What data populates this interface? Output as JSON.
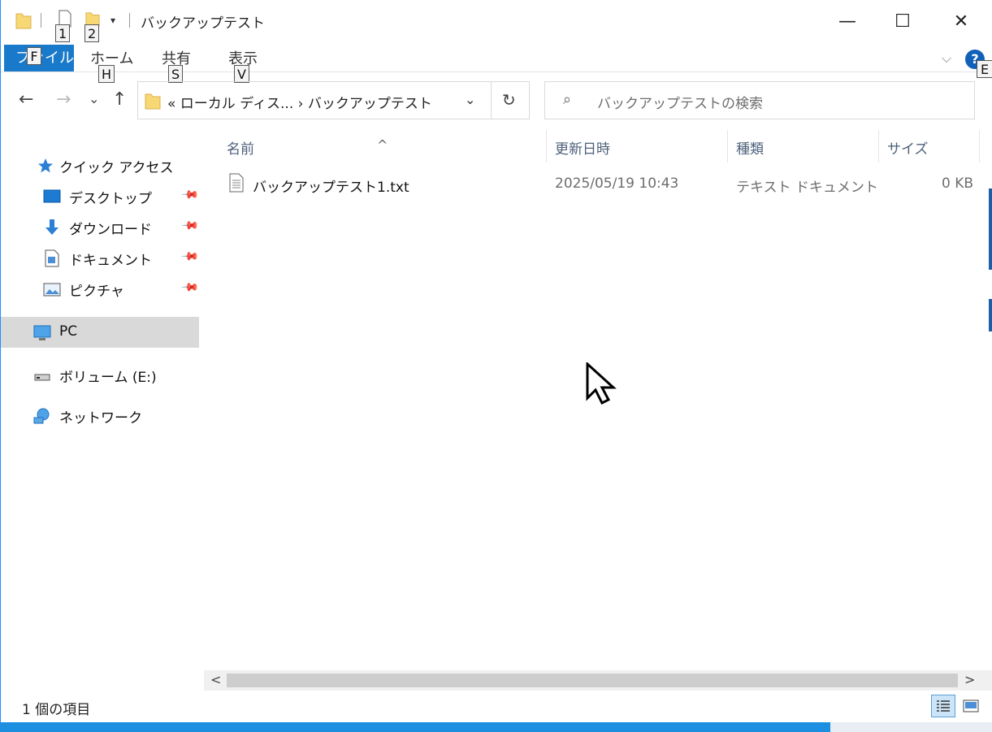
{
  "window": {
    "title": "バックアップテスト",
    "qat_keytips": [
      "1",
      "2"
    ],
    "qat_dropdown": "▾",
    "minimize": "—",
    "maximize": "☐",
    "close": "✕"
  },
  "ribbon": {
    "tabs": [
      {
        "label": "ファイル",
        "keytip": "F"
      },
      {
        "label": "ホーム",
        "keytip": "H"
      },
      {
        "label": "共有",
        "keytip": "S"
      },
      {
        "label": "表示",
        "keytip": "V"
      }
    ],
    "expand": "⌵",
    "help": "?",
    "help_keytip": "E"
  },
  "nav": {
    "back": "←",
    "forward": "→",
    "recent": "⌄",
    "up": "↑",
    "address_text": "«  ローカル ディス...  ›  バックアップテスト",
    "address_chevron": "⌄",
    "refresh": "↻",
    "search_placeholder": "バックアップテストの検索",
    "search_icon": "⌕"
  },
  "sidebar": {
    "items": [
      {
        "label": "クイック アクセス",
        "icon": "star-icon"
      },
      {
        "label": "デスクトップ",
        "icon": "desktop-icon",
        "pinned": true
      },
      {
        "label": "ダウンロード",
        "icon": "download-icon",
        "pinned": true
      },
      {
        "label": "ドキュメント",
        "icon": "documents-icon",
        "pinned": true
      },
      {
        "label": "ピクチャ",
        "icon": "pictures-icon",
        "pinned": true
      },
      {
        "label": "PC",
        "icon": "pc-icon",
        "selected": true
      },
      {
        "label": "ボリューム (E:)",
        "icon": "drive-icon"
      },
      {
        "label": "ネットワーク",
        "icon": "network-icon"
      }
    ],
    "pin_glyph": "📌"
  },
  "table": {
    "columns": [
      "名前",
      "更新日時",
      "種類",
      "サイズ"
    ],
    "sort_glyph": "^",
    "rows": [
      {
        "name": "バックアップテスト1.txt",
        "modified": "2025/05/19 10:43",
        "type": "テキスト ドキュメント",
        "size": "0 KB"
      }
    ]
  },
  "scrollbar": {
    "left": "<",
    "right": ">"
  },
  "status": {
    "item_count": "1 個の項目"
  },
  "colors": {
    "accent": "#1979ca",
    "selection": "#d9d9d9",
    "header_text": "#4c607a"
  }
}
